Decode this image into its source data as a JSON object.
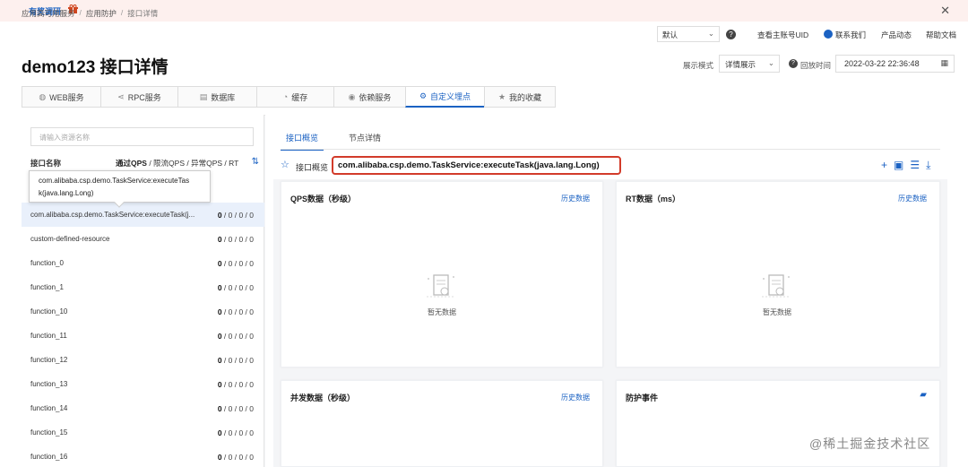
{
  "banner": {
    "survey": "有奖调研",
    "gift_icon": "gift-icon",
    "close": "✕"
  },
  "breadcrumb": [
    "应用高可用服务",
    "应用防护",
    "接口详情"
  ],
  "breadcrumb_sep": "/",
  "topbar": {
    "region": "默认",
    "uid_link": "查看主账号UID",
    "contact": "联系我们",
    "news": "产品动态",
    "docs": "帮助文档"
  },
  "page_title": "demo123 接口详情",
  "view_mode": {
    "label": "展示模式",
    "value": "详情展示"
  },
  "back_time": {
    "label": "回放时间",
    "value": "2022-03-22 22:36:48"
  },
  "tabs": [
    {
      "label": "WEB服务",
      "icon": "globe-icon"
    },
    {
      "label": "RPC服务",
      "icon": "share-icon"
    },
    {
      "label": "数据库",
      "icon": "database-icon"
    },
    {
      "label": "缓存",
      "icon": "cache-icon"
    },
    {
      "label": "依赖服务",
      "icon": "dependency-icon"
    },
    {
      "label": "自定义埋点",
      "icon": "gear-icon",
      "active": true
    },
    {
      "label": "我的收藏",
      "icon": "star-icon"
    }
  ],
  "left": {
    "search_placeholder": "请输入资源名称",
    "col_name": "接口名称",
    "col_pass": "通过QPS",
    "col_rest": "/ 限流QPS / 异常QPS / RT",
    "tooltip_line1": "com.alibaba.csp.demo.TaskService:executeTas",
    "tooltip_line2": "k(java.lang.Long)",
    "rows": [
      {
        "name": "com.alibaba.csp.demo.TaskService:executeTask(j...",
        "first": "0",
        "rest": " / 0 / 0 / 0",
        "selected": true
      },
      {
        "name": "custom-defined-resource",
        "first": "0",
        "rest": " / 0 / 0 / 0"
      },
      {
        "name": "function_0",
        "first": "0",
        "rest": " / 0 / 0 / 0"
      },
      {
        "name": "function_1",
        "first": "0",
        "rest": " / 0 / 0 / 0"
      },
      {
        "name": "function_10",
        "first": "0",
        "rest": " / 0 / 0 / 0"
      },
      {
        "name": "function_11",
        "first": "0",
        "rest": " / 0 / 0 / 0"
      },
      {
        "name": "function_12",
        "first": "0",
        "rest": " / 0 / 0 / 0"
      },
      {
        "name": "function_13",
        "first": "0",
        "rest": " / 0 / 0 / 0"
      },
      {
        "name": "function_14",
        "first": "0",
        "rest": " / 0 / 0 / 0"
      },
      {
        "name": "function_15",
        "first": "0",
        "rest": " / 0 / 0 / 0"
      },
      {
        "name": "function_16",
        "first": "0",
        "rest": " / 0 / 0 / 0"
      }
    ]
  },
  "right": {
    "subtabs": [
      "接口概览",
      "节点详情"
    ],
    "overview_label": "接口概览",
    "resource": "com.alibaba.csp.demo.TaskService:executeTask(java.lang.Long)",
    "cards": {
      "qps": {
        "title": "QPS数据（秒级）",
        "history": "历史数据",
        "empty": "暂无数据"
      },
      "rt": {
        "title": "RT数据（ms）",
        "history": "历史数据",
        "empty": "暂无数据"
      },
      "concurrency": {
        "title": "并发数据（秒级）",
        "history": "历史数据"
      },
      "events": {
        "title": "防护事件"
      }
    }
  },
  "watermark": "@稀土掘金技术社区",
  "colors": {
    "accent": "#1b62c3",
    "highlight": "#d23b2a",
    "banner_bg": "#fdf0ee"
  }
}
